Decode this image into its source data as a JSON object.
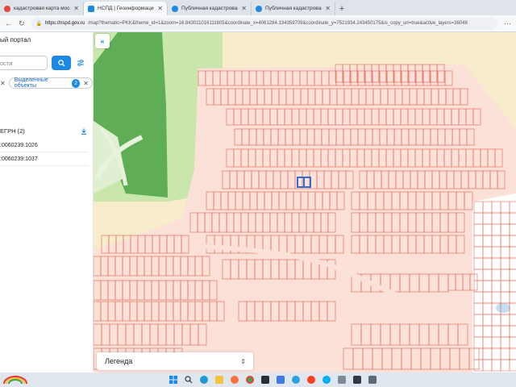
{
  "browser": {
    "tabs": [
      {
        "title": "кадастровая карта московско",
        "color": "#e8453c",
        "active": false
      },
      {
        "title": "НСПД | Геоинформационный",
        "color": "#1e88e5",
        "active": true
      },
      {
        "title": "Публичная кадастровая карта",
        "color": "#1e88e5",
        "active": false
      },
      {
        "title": "Публичная кадастровая карта Р",
        "color": "#1e88e5",
        "active": false
      }
    ],
    "new_tab": "+",
    "url_host": "https://nspd.gov.ru",
    "url_rest": "/map?thematic=PKK&theme_id=1&zoom=16.843011016111805&coordinate_x=4061284.134359709&coordinate_y=7521934.243450175&is_copy_url=true&active_layers=36048"
  },
  "sidebar": {
    "portal_title": "ый портал",
    "search_placeholder": "ости",
    "selected_chip_label": "Выделенные объекты",
    "selected_count": "2",
    "egrn_label": "ЕГРН (2)",
    "results": [
      ":0060239:1026",
      ":0060239:1037"
    ]
  },
  "map": {
    "legend_label": "Легенда",
    "legend_toggle": "⌃⌄",
    "colors": {
      "parcel": "#e8735f",
      "forest": "#62b35a",
      "meadow": "#bfe3a5",
      "selection": "#2e6fd6"
    }
  },
  "taskbar": {
    "apps": [
      "windows-start",
      "search",
      "edge",
      "file-explorer",
      "firefox",
      "chrome",
      "vpn",
      "photos",
      "telegram",
      "yandex",
      "skype",
      "mail",
      "monitor",
      "store"
    ]
  }
}
